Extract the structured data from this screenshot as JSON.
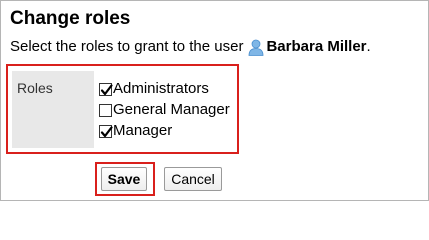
{
  "page": {
    "title": "Change roles"
  },
  "instruction": {
    "text": "Select the roles to grant to the user",
    "user_name": "Barbara Miller",
    "trailing": ".",
    "user_icon": "user-icon"
  },
  "roles": {
    "label": "Roles",
    "items": [
      {
        "label": "Administrators",
        "checked": true
      },
      {
        "label": "General Manager",
        "checked": false
      },
      {
        "label": "Manager",
        "checked": true
      }
    ]
  },
  "buttons": {
    "save_label": "Save",
    "cancel_label": "Cancel"
  },
  "colors": {
    "highlight": "#d9201c",
    "label_cell_bg": "#e8e8e8",
    "user_icon": "#6fa8dc"
  }
}
